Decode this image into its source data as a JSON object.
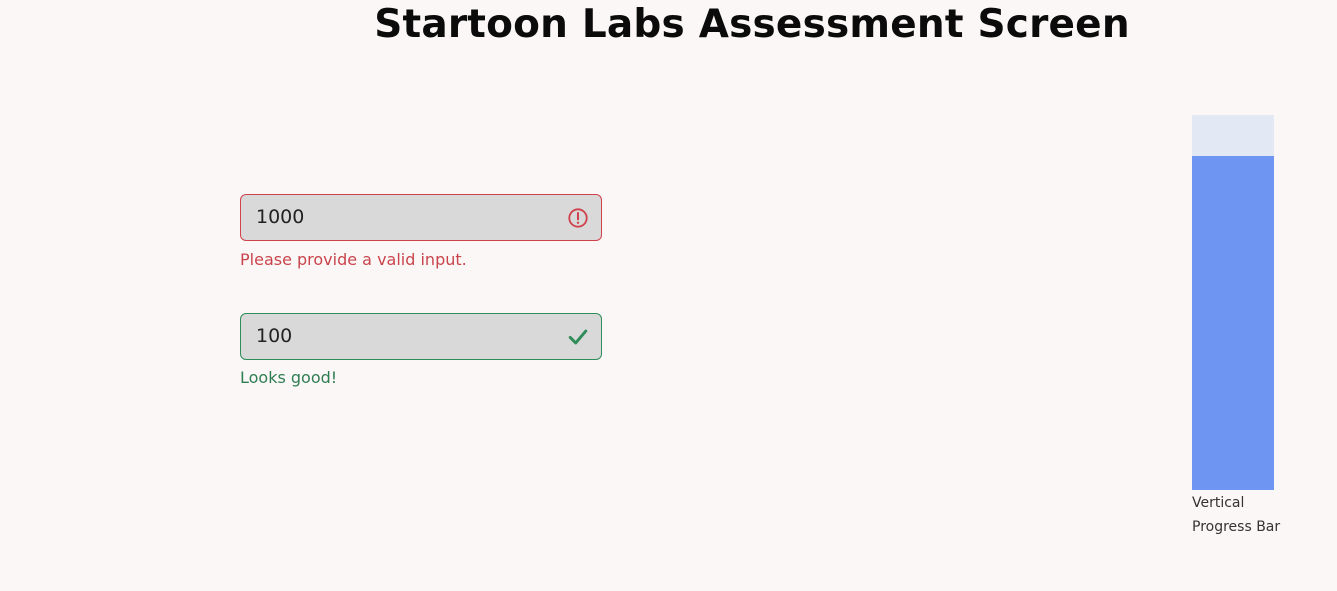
{
  "header": {
    "title": "Startoon Labs Assessment Screen"
  },
  "form": {
    "invalid_field": {
      "value": "1000",
      "icon": "alert-circle-icon",
      "feedback": "Please provide a valid input.",
      "color": "#d0424b"
    },
    "valid_field": {
      "value": "100",
      "icon": "check-icon",
      "feedback": "Looks good!",
      "color": "#2f8d5a"
    }
  },
  "progress": {
    "label": "Vertical Progress Bar",
    "value_fraction": 0.89,
    "track_color": "#e2e9f4",
    "fill_color": "#6f95f2"
  }
}
